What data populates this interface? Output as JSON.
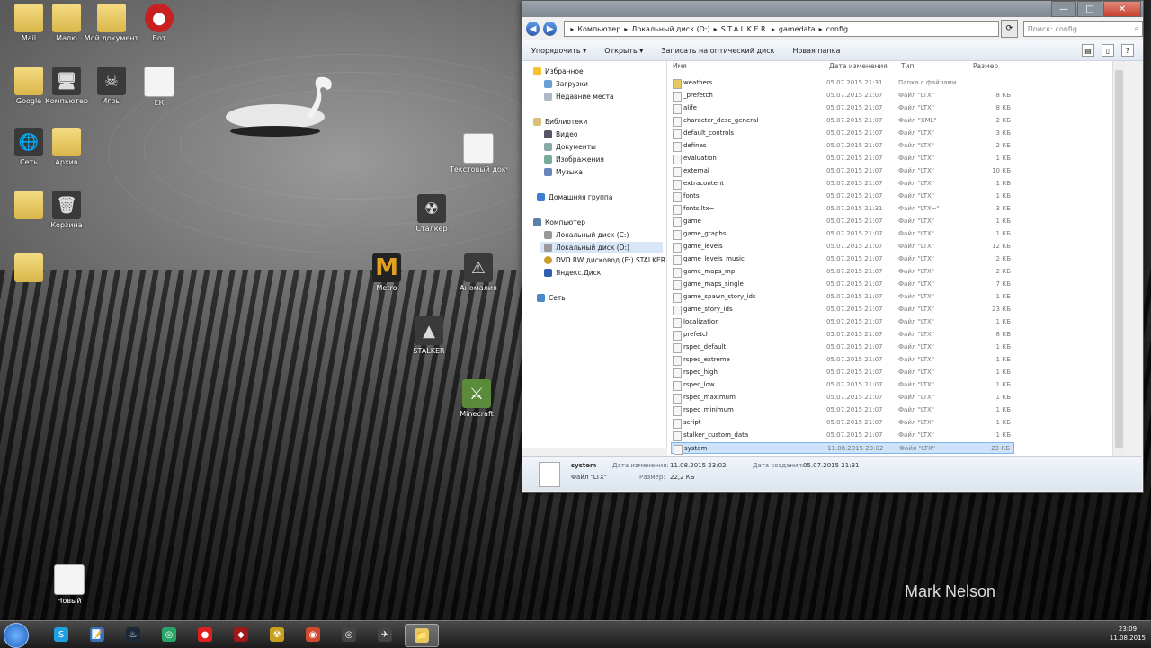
{
  "desktop": {
    "icons": [
      {
        "label": "Mail",
        "glyph": "",
        "kind": "folder"
      },
      {
        "label": "Малю",
        "glyph": "",
        "kind": "folder"
      },
      {
        "label": "Мой документ",
        "glyph": "",
        "kind": "folder"
      },
      {
        "label": "Вот",
        "glyph": "●",
        "kind": "app-red"
      },
      {
        "label": "Google",
        "glyph": "",
        "kind": "folder"
      },
      {
        "label": "Компьютер",
        "glyph": "🖥",
        "kind": "app"
      },
      {
        "label": "Игры",
        "glyph": "☠",
        "kind": "app"
      },
      {
        "label": "ЕК",
        "glyph": "",
        "kind": "file"
      },
      {
        "label": "Сеть",
        "glyph": "🌐",
        "kind": "app"
      },
      {
        "label": "Архив",
        "glyph": "",
        "kind": "folder"
      },
      {
        "label": "",
        "glyph": "",
        "kind": "folder"
      },
      {
        "label": "Корзина",
        "glyph": "🗑",
        "kind": "app"
      },
      {
        "label": "",
        "glyph": "",
        "kind": "folder"
      },
      {
        "label": "Текстовый документ",
        "glyph": "",
        "kind": "file"
      },
      {
        "label": "Сталкер",
        "glyph": "☢",
        "kind": "app"
      },
      {
        "label": "Metro",
        "glyph": "M",
        "kind": "app-metro"
      },
      {
        "label": "Аномалия",
        "glyph": "⚠",
        "kind": "app"
      },
      {
        "label": "STALKER",
        "glyph": "▲",
        "kind": "app"
      },
      {
        "label": "Minecraft",
        "glyph": "⚔",
        "kind": "app-green"
      },
      {
        "label": "Новый",
        "glyph": "",
        "kind": "file"
      }
    ],
    "watermark": "Mark Nelson"
  },
  "window": {
    "controls": {
      "minimize": "—",
      "maximize": "□",
      "close": "✕"
    },
    "address": [
      "Компьютер",
      "Локальный диск (D:)",
      "S.T.A.L.K.E.R.",
      "gamedata",
      "config"
    ],
    "search_placeholder": "Поиск: config",
    "toolbar": {
      "organize": "Упорядочить ▾",
      "open": "Открыть ▾",
      "burn": "Записать на оптический диск",
      "new_folder": "Новая папка"
    },
    "nav": {
      "favorites": "Избранное",
      "downloads": "Загрузки",
      "recent": "Недавние места",
      "libraries": "Библиотеки",
      "video": "Видео",
      "documents": "Документы",
      "images": "Изображения",
      "music": "Музыка",
      "homegroup": "Домашняя группа",
      "computer": "Компьютер",
      "disk_c": "Локальный диск (C:)",
      "disk_d": "Локальный диск (D:)",
      "dvd": "DVD RW дисковод (E:) STALKER",
      "yandex": "Яндекс.Диск",
      "network": "Сеть"
    },
    "columns": {
      "name": "Имя",
      "date": "Дата изменения",
      "type": "Тип",
      "size": "Размер"
    },
    "files": [
      {
        "name": "weathers",
        "date": "05.07.2015 21:31",
        "type": "Папка с файлами",
        "size": ""
      },
      {
        "name": "_prefetch",
        "date": "05.07.2015 21:07",
        "type": "Файл \"LTX\"",
        "size": "8 КБ"
      },
      {
        "name": "alife",
        "date": "05.07.2015 21:07",
        "type": "Файл \"LTX\"",
        "size": "8 КБ"
      },
      {
        "name": "character_desc_general",
        "date": "05.07.2015 21:07",
        "type": "Файл \"XML\"",
        "size": "2 КБ"
      },
      {
        "name": "default_controls",
        "date": "05.07.2015 21:07",
        "type": "Файл \"LTX\"",
        "size": "3 КБ"
      },
      {
        "name": "defines",
        "date": "05.07.2015 21:07",
        "type": "Файл \"LTX\"",
        "size": "2 КБ"
      },
      {
        "name": "evaluation",
        "date": "05.07.2015 21:07",
        "type": "Файл \"LTX\"",
        "size": "1 КБ"
      },
      {
        "name": "external",
        "date": "05.07.2015 21:07",
        "type": "Файл \"LTX\"",
        "size": "10 КБ"
      },
      {
        "name": "extracontent",
        "date": "05.07.2015 21:07",
        "type": "Файл \"LTX\"",
        "size": "1 КБ"
      },
      {
        "name": "fonts",
        "date": "05.07.2015 21:07",
        "type": "Файл \"LTX\"",
        "size": "1 КБ"
      },
      {
        "name": "fonts.ltx~",
        "date": "05.07.2015 21:31",
        "type": "Файл \"LTX~\"",
        "size": "3 КБ"
      },
      {
        "name": "game",
        "date": "05.07.2015 21:07",
        "type": "Файл \"LTX\"",
        "size": "1 КБ"
      },
      {
        "name": "game_graphs",
        "date": "05.07.2015 21:07",
        "type": "Файл \"LTX\"",
        "size": "1 КБ"
      },
      {
        "name": "game_levels",
        "date": "05.07.2015 21:07",
        "type": "Файл \"LTX\"",
        "size": "12 КБ"
      },
      {
        "name": "game_levels_music",
        "date": "05.07.2015 21:07",
        "type": "Файл \"LTX\"",
        "size": "2 КБ"
      },
      {
        "name": "game_maps_mp",
        "date": "05.07.2015 21:07",
        "type": "Файл \"LTX\"",
        "size": "2 КБ"
      },
      {
        "name": "game_maps_single",
        "date": "05.07.2015 21:07",
        "type": "Файл \"LTX\"",
        "size": "7 КБ"
      },
      {
        "name": "game_spawn_story_ids",
        "date": "05.07.2015 21:07",
        "type": "Файл \"LTX\"",
        "size": "1 КБ"
      },
      {
        "name": "game_story_ids",
        "date": "05.07.2015 21:07",
        "type": "Файл \"LTX\"",
        "size": "23 КБ"
      },
      {
        "name": "localization",
        "date": "05.07.2015 21:07",
        "type": "Файл \"LTX\"",
        "size": "1 КБ"
      },
      {
        "name": "prefetch",
        "date": "05.07.2015 21:07",
        "type": "Файл \"LTX\"",
        "size": "8 КБ"
      },
      {
        "name": "rspec_default",
        "date": "05.07.2015 21:07",
        "type": "Файл \"LTX\"",
        "size": "1 КБ"
      },
      {
        "name": "rspec_extreme",
        "date": "05.07.2015 21:07",
        "type": "Файл \"LTX\"",
        "size": "1 КБ"
      },
      {
        "name": "rspec_high",
        "date": "05.07.2015 21:07",
        "type": "Файл \"LTX\"",
        "size": "1 КБ"
      },
      {
        "name": "rspec_low",
        "date": "05.07.2015 21:07",
        "type": "Файл \"LTX\"",
        "size": "1 КБ"
      },
      {
        "name": "rspec_maximum",
        "date": "05.07.2015 21:07",
        "type": "Файл \"LTX\"",
        "size": "1 КБ"
      },
      {
        "name": "rspec_minimum",
        "date": "05.07.2015 21:07",
        "type": "Файл \"LTX\"",
        "size": "1 КБ"
      },
      {
        "name": "script",
        "date": "05.07.2015 21:07",
        "type": "Файл \"LTX\"",
        "size": "1 КБ"
      },
      {
        "name": "stalker_custom_data",
        "date": "05.07.2015 21:07",
        "type": "Файл \"LTX\"",
        "size": "1 КБ"
      },
      {
        "name": "system",
        "date": "11.08.2015 23:02",
        "type": "Файл \"LTX\"",
        "size": "23 КБ"
      }
    ],
    "details": {
      "name": "system",
      "type": "Файл \"LTX\"",
      "modified_label": "Дата изменения:",
      "modified_value": "11.08.2015 23:02",
      "size_label": "Размер:",
      "size_value": "22,2 КБ",
      "created_label": "Дата создания:",
      "created_value": "05.07.2015 21:31"
    }
  },
  "taskbar": {
    "apps": [
      {
        "name": "skype",
        "glyph": "S",
        "color": "#1fa0e0"
      },
      {
        "name": "notepad",
        "glyph": "📝",
        "color": "#3b6fb6"
      },
      {
        "name": "steam",
        "glyph": "♨",
        "color": "#1b2838"
      },
      {
        "name": "games",
        "glyph": "◎",
        "color": "#2aa56a"
      },
      {
        "name": "record",
        "glyph": "●",
        "color": "#e02020"
      },
      {
        "name": "dota",
        "glyph": "◆",
        "color": "#a01818"
      },
      {
        "name": "stalker",
        "glyph": "☢",
        "color": "#c8a020"
      },
      {
        "name": "chrome",
        "glyph": "◉",
        "color": "#d04a30"
      },
      {
        "name": "app1",
        "glyph": "◎",
        "color": "#444"
      },
      {
        "name": "app2",
        "glyph": "✈",
        "color": "#444"
      },
      {
        "name": "explorer",
        "glyph": "📁",
        "color": "#e8c860"
      }
    ],
    "clock": {
      "time": "23:09",
      "date": "11.08.2015"
    }
  }
}
